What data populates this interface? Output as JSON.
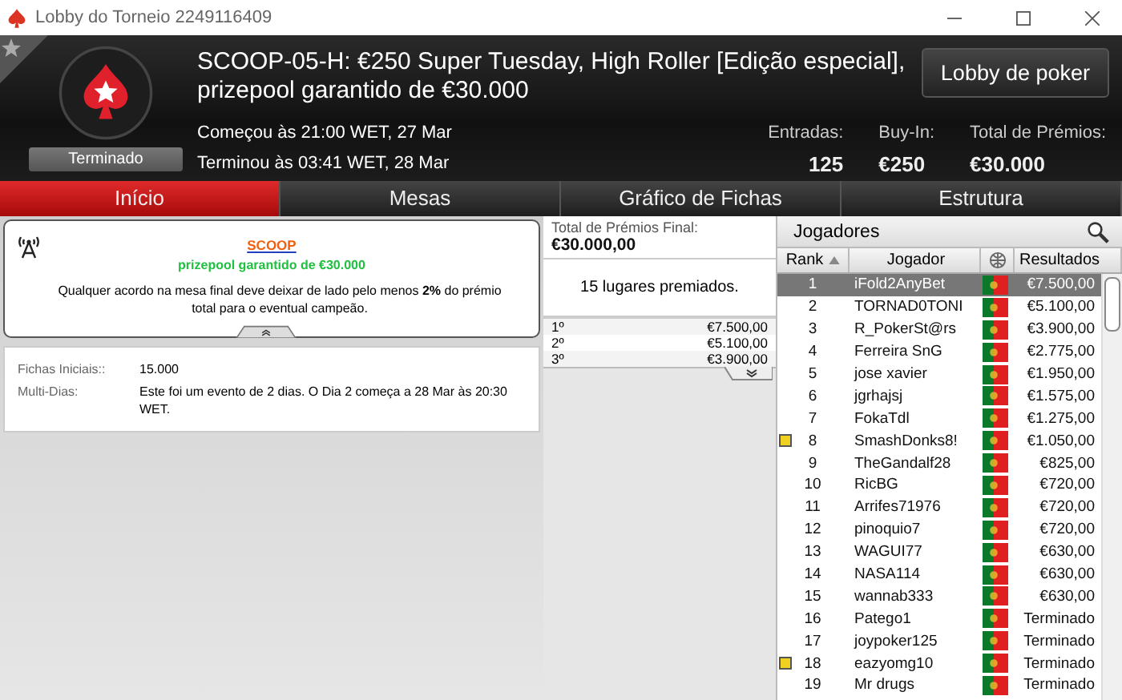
{
  "window": {
    "title": "Lobby do Torneio 2249116409"
  },
  "header": {
    "title": "SCOOP-05-H: €250 Super Tuesday, High Roller [Edição especial], prizepool garantido de €30.000",
    "status": "Terminado",
    "started": "Começou às 21:00 WET, 27 Mar",
    "ended": "Terminou às 03:41 WET, 28 Mar",
    "lobby_button": "Lobby de poker",
    "stats": [
      {
        "label": "Entradas:",
        "value": "125"
      },
      {
        "label": "Buy-In:",
        "value": "€250"
      },
      {
        "label": "Total de Prémios:",
        "value": "€30.000"
      }
    ]
  },
  "tabs": [
    {
      "label": "Início",
      "selected": true
    },
    {
      "label": "Mesas",
      "selected": false
    },
    {
      "label": "Gráfico de Fichas",
      "selected": false
    },
    {
      "label": "Estrutura",
      "selected": false
    }
  ],
  "info": {
    "link": "SCOOP",
    "subtitle": "prizepool garantido de €30.000",
    "text": "Qualquer acordo na mesa final deve deixar de lado pelo menos **2%** do prémio total para o eventual campeão."
  },
  "details": [
    {
      "label": "Fichas Iniciais::",
      "value": "15.000"
    },
    {
      "label": "Multi-Dias:",
      "value": "Este foi um evento de 2 dias. O Dia 2 começa a 28 Mar às 20:30 WET."
    }
  ],
  "prizes": {
    "label": "Total de Prémios Final:",
    "total": "€30.000,00",
    "places": "15 lugares premiados.",
    "rows": [
      {
        "place": "1º",
        "amount": "€7.500,00"
      },
      {
        "place": "2º",
        "amount": "€5.100,00"
      },
      {
        "place": "3º",
        "amount": "€3.900,00"
      }
    ]
  },
  "players": {
    "title": "Jogadores",
    "columns": [
      "Rank",
      "Jogador",
      "Resultados"
    ],
    "rows": [
      {
        "rank": "1",
        "name": "iFold2AnyBet",
        "result": "€7.500,00",
        "selected": true,
        "marked": false
      },
      {
        "rank": "2",
        "name": "TORNAD0TONI",
        "result": "€5.100,00",
        "selected": false,
        "marked": false
      },
      {
        "rank": "3",
        "name": "R_PokerSt@rs",
        "result": "€3.900,00",
        "selected": false,
        "marked": false
      },
      {
        "rank": "4",
        "name": "Ferreira SnG",
        "result": "€2.775,00",
        "selected": false,
        "marked": false
      },
      {
        "rank": "5",
        "name": "jose xavier",
        "result": "€1.950,00",
        "selected": false,
        "marked": false
      },
      {
        "rank": "6",
        "name": "jgrhajsj",
        "result": "€1.575,00",
        "selected": false,
        "marked": false
      },
      {
        "rank": "7",
        "name": "FokaTdl",
        "result": "€1.275,00",
        "selected": false,
        "marked": false
      },
      {
        "rank": "8",
        "name": "SmashDonks8!",
        "result": "€1.050,00",
        "selected": false,
        "marked": true
      },
      {
        "rank": "9",
        "name": "TheGandalf28",
        "result": "€825,00",
        "selected": false,
        "marked": false
      },
      {
        "rank": "10",
        "name": "RicBG",
        "result": "€720,00",
        "selected": false,
        "marked": false
      },
      {
        "rank": "11",
        "name": "Arrifes71976",
        "result": "€720,00",
        "selected": false,
        "marked": false
      },
      {
        "rank": "12",
        "name": "pinoquio7",
        "result": "€720,00",
        "selected": false,
        "marked": false
      },
      {
        "rank": "13",
        "name": "WAGUI77",
        "result": "€630,00",
        "selected": false,
        "marked": false
      },
      {
        "rank": "14",
        "name": "NASA114",
        "result": "€630,00",
        "selected": false,
        "marked": false
      },
      {
        "rank": "15",
        "name": "wannab333",
        "result": "€630,00",
        "selected": false,
        "marked": false
      },
      {
        "rank": "16",
        "name": "Patego1",
        "result": "Terminado",
        "selected": false,
        "marked": false
      },
      {
        "rank": "17",
        "name": "joypoker125",
        "result": "Terminado",
        "selected": false,
        "marked": false
      },
      {
        "rank": "18",
        "name": "eazyomg10",
        "result": "Terminado",
        "selected": false,
        "marked": true
      },
      {
        "rank": "19",
        "name": "Mr drugs",
        "result": "Terminado",
        "selected": false,
        "marked": false
      }
    ]
  }
}
